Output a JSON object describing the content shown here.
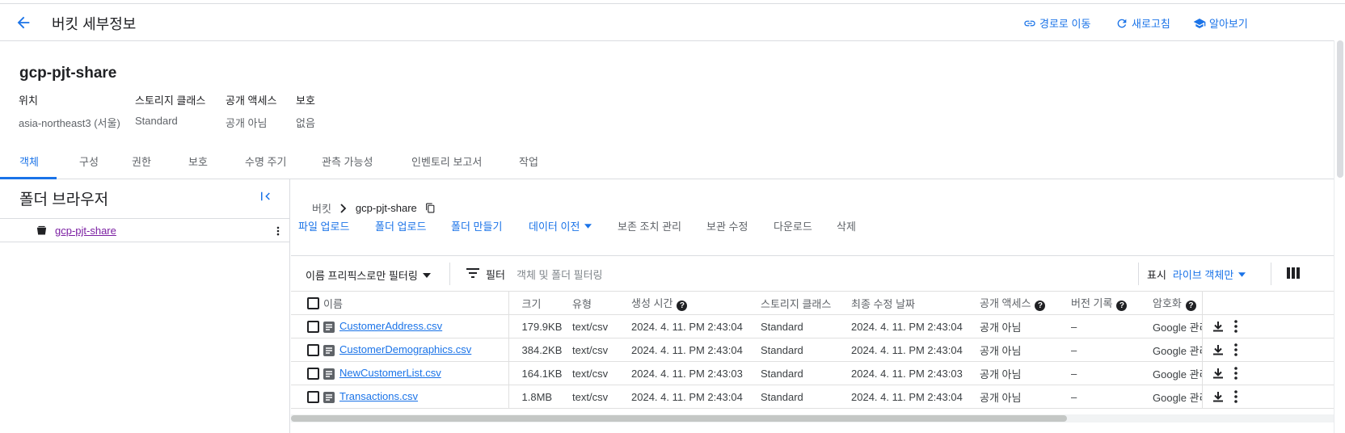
{
  "header": {
    "title": "버킷 세부정보",
    "actions": [
      {
        "label": "경로로 이동",
        "icon": "link-icon"
      },
      {
        "label": "새로고침",
        "icon": "refresh-icon"
      },
      {
        "label": "알아보기",
        "icon": "school-icon"
      }
    ]
  },
  "bucket": {
    "name": "gcp-pjt-share",
    "meta": [
      {
        "key": "위치",
        "value": "asia-northeast3 (서울)"
      },
      {
        "key": "스토리지 클래스",
        "value": "Standard"
      },
      {
        "key": "공개 액세스",
        "value": "공개 아님"
      },
      {
        "key": "보호",
        "value": "없음"
      }
    ]
  },
  "tabs": [
    "객체",
    "구성",
    "권한",
    "보호",
    "수명 주기",
    "관측 가능성",
    "인벤토리 보고서",
    "작업"
  ],
  "active_tab": "객체",
  "folder_browser": {
    "title": "폴더 브라우저",
    "item": "gcp-pjt-share"
  },
  "breadcrumb": {
    "root": "버킷",
    "current": "gcp-pjt-share"
  },
  "actions": [
    {
      "label": "파일 업로드",
      "enabled": true
    },
    {
      "label": "폴더 업로드",
      "enabled": true
    },
    {
      "label": "폴더 만들기",
      "enabled": true
    },
    {
      "label": "데이터 이전",
      "enabled": true
    },
    {
      "label": "보존 조치 관리",
      "enabled": false
    },
    {
      "label": "보관 수정",
      "enabled": false
    },
    {
      "label": "다운로드",
      "enabled": false
    },
    {
      "label": "삭제",
      "enabled": false
    }
  ],
  "filter": {
    "prefix_select": "이름 프리픽스로만 필터링",
    "label": "필터",
    "placeholder": "객체 및 폴더 필터링",
    "show_label": "표시",
    "show_value": "라이브 객체만"
  },
  "table": {
    "columns": [
      "이름",
      "크기",
      "유형",
      "생성 시간",
      "스토리지 클래스",
      "최종 수정 날짜",
      "공개 액세스",
      "버전 기록",
      "암호화"
    ],
    "rows": [
      [
        "CustomerAddress.csv",
        "179.9KB",
        "text/csv",
        "2024. 4. 11. PM 2:43:04",
        "Standard",
        "2024. 4. 11. PM 2:43:04",
        "공개 아님",
        "–",
        "Google 관리"
      ],
      [
        "CustomerDemographics.csv",
        "384.2KB",
        "text/csv",
        "2024. 4. 11. PM 2:43:04",
        "Standard",
        "2024. 4. 11. PM 2:43:04",
        "공개 아님",
        "–",
        "Google 관리"
      ],
      [
        "NewCustomerList.csv",
        "164.1KB",
        "text/csv",
        "2024. 4. 11. PM 2:43:03",
        "Standard",
        "2024. 4. 11. PM 2:43:03",
        "공개 아님",
        "–",
        "Google 관리"
      ],
      [
        "Transactions.csv",
        "1.8MB",
        "text/csv",
        "2024. 4. 11. PM 2:43:04",
        "Standard",
        "2024. 4. 11. PM 2:43:04",
        "공개 아님",
        "–",
        "Google 관리"
      ]
    ]
  },
  "colors": {
    "accent": "#1a73e8",
    "visited": "#7b1fa2"
  }
}
